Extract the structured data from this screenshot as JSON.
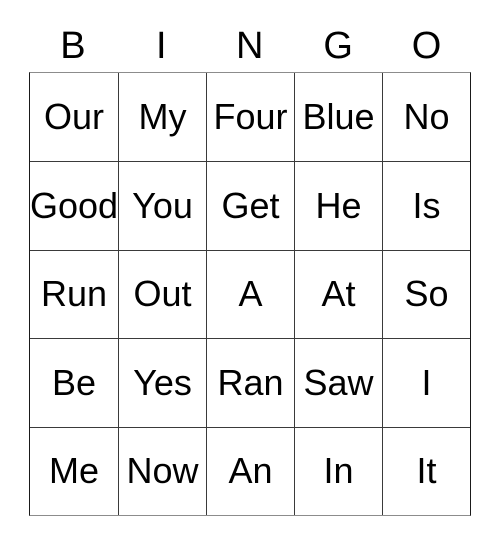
{
  "card": {
    "title": "BINGO",
    "headers": [
      "B",
      "I",
      "N",
      "G",
      "O"
    ],
    "rows": [
      [
        "Our",
        "My",
        "Four",
        "Blue",
        "No"
      ],
      [
        "Good",
        "You",
        "Get",
        "He",
        "Is"
      ],
      [
        "Run",
        "Out",
        "A",
        "At",
        "So"
      ],
      [
        "Be",
        "Yes",
        "Ran",
        "Saw",
        "I"
      ],
      [
        "Me",
        "Now",
        "An",
        "In",
        "It"
      ]
    ],
    "colors": {
      "text": "#000000",
      "background": "#ffffff",
      "grid_line": "#3a3a3a",
      "outer_border": "#8c8c8c"
    }
  }
}
